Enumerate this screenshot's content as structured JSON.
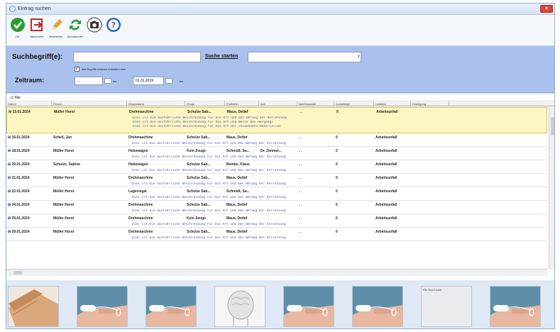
{
  "window": {
    "title": "Eintrag suchen",
    "close_label": "✕"
  },
  "toolbar": {
    "buttons": [
      {
        "label": "OK",
        "icon": "check-icon",
        "color": "#2a9d2f"
      },
      {
        "label": "Abbrechen",
        "icon": "exit-icon",
        "color": "#c62828"
      },
      {
        "label": "Bearbeiten",
        "icon": "pencil-icon",
        "color": "#e0a53b"
      },
      {
        "label": "Aktualisieren",
        "icon": "refresh-icon",
        "color": "#2e9b3c"
      },
      {
        "label": "",
        "icon": "camera-icon",
        "color": "#333333"
      },
      {
        "label": "",
        "icon": "help-icon",
        "color": "#2f63c6"
      }
    ]
  },
  "search": {
    "term_label": "Suchbegriff(e):",
    "term_value": "",
    "start_label": "Suche starten",
    "option_value": "",
    "all_terms_label": "alle Begriffe müssen enthalten sein",
    "all_terms_checked": true,
    "period_label": "Zeitraum:",
    "date_from": "...",
    "date_to": "01.01.2019",
    "bis_label": "bis"
  },
  "list": {
    "select_all_label": "Alle",
    "columns": [
      "Datum",
      "Person",
      "Gegenstand",
      "Zeuge",
      "Ersthelfer",
      "Arzt",
      "Arbeitsausfall",
      "Ausfalltage",
      "Unfallart",
      "Erledigung"
    ],
    "rows": [
      {
        "date": "15.01.2024",
        "person": "Müller Horst",
        "item": "Drehmaschine",
        "witness": "Schulze Sab...",
        "helper": "Maus, Detlef",
        "doctor": "",
        "absence": ". .",
        "days": "0",
        "type": "Arbeitsunfall",
        "desc": [
          "Dies ist die ausführliche Beschreibung für die Art und den Umfang der Verletzung",
          "Dies ist die ausführliche Beschreibung für die Art und Weise des Hergangs",
          "Dies ist die ausführliche Beschreibung für die Art der verwendete Materialien"
        ],
        "selected": true
      },
      {
        "date": "16.01.2024",
        "person": "Schell, Jan",
        "item": "Drehmaschine",
        "witness": "Schulze Sab...",
        "helper": "Maus, Detlef",
        "doctor": "",
        "absence": ". .",
        "days": "0",
        "type": "Arbeitsunfall",
        "desc": [
          "Dies ist die ausführliche Beschreibung für die Art und den Umfang der Verletzung"
        ],
        "selected": false
      },
      {
        "date": "18.01.2024",
        "person": "Müller Horst",
        "item": "Hebewagen",
        "witness": "Kein Zeuge",
        "helper": "Schmidt, Sa...",
        "doctor": "Dr. Zimmer...",
        "absence": ". .",
        "days": "0",
        "type": "Arbeitsunfall",
        "desc": [
          "Dies ist die ausführliche Beschreibung für die Art und den Umfang der Verletzung"
        ],
        "selected": false
      },
      {
        "date": "20.01.2024",
        "person": "Schulze, Sabine",
        "item": "Hebewagen",
        "witness": "Schulze Sab...",
        "helper": "Beinke, Klaus",
        "doctor": "",
        "absence": ". .",
        "days": "0",
        "type": "Arbeitsunfall",
        "desc": [
          "Dies ist die ausführliche Beschreibung für die Art und den Umfang der Verletzung"
        ],
        "selected": false
      },
      {
        "date": "21.01.2024",
        "person": "Müller Horst",
        "item": "Drehmaschine",
        "witness": "Schulze Sab...",
        "helper": "Maus, Detlef",
        "doctor": "",
        "absence": ". .",
        "days": "0",
        "type": "Arbeitsunfall",
        "desc": [
          "Dies ist die ausführliche Beschreibung für die Art und den Umfang der Verletzung"
        ],
        "selected": false
      },
      {
        "date": "22.01.2024",
        "person": "Müller Horst",
        "item": "Lagerregal",
        "witness": "Schulze Sab...",
        "helper": "Schmidt, Sa...",
        "doctor": "",
        "absence": ". .",
        "days": "0",
        "type": "Arbeitsunfall",
        "desc": [
          "Dies ist die ausführliche Beschreibung für die Art und den Umfang der Verletzung"
        ],
        "selected": false
      },
      {
        "date": "24.01.2024",
        "person": "Müller Horst",
        "item": "Drehmaschine",
        "witness": "Schulze Sab...",
        "helper": "Maus, Detlef",
        "doctor": "",
        "absence": ". .",
        "days": "0",
        "type": "Arbeitsunfall",
        "desc": [
          "Dies ist die ausführliche Beschreibung für die Art und den Umfang der Verletzung"
        ],
        "selected": false
      },
      {
        "date": "25.01.2024",
        "person": "Müller Horst",
        "item": "Drehmaschine",
        "witness": "Kein Zeuge",
        "helper": "Maus, Detlef",
        "doctor": "",
        "absence": ". .",
        "days": "0",
        "type": "Arbeitsunfall",
        "desc": [
          "Dies ist die ausführliche Beschreibung für die Art und den Umfang der Verletzung"
        ],
        "selected": false
      },
      {
        "date": "29.01.2024",
        "person": "Müller Horst",
        "item": "Drehmaschine",
        "witness": "Schulze Sab...",
        "helper": "Maus, Detlef",
        "doctor": "",
        "absence": ". .",
        "days": "0",
        "type": "Arbeitsunfall",
        "desc": [
          "Dies ist die ausführliche Beschreibung für die Art und den Umfang der Verletzung"
        ],
        "selected": false
      }
    ]
  },
  "pictures": [
    {
      "kind": "bandage"
    },
    {
      "kind": "finger"
    },
    {
      "kind": "finger"
    },
    {
      "kind": "head"
    },
    {
      "kind": "finger"
    },
    {
      "kind": "finger"
    },
    {
      "kind": "nopic",
      "label": "File Not Found"
    },
    {
      "kind": "finger"
    }
  ]
}
